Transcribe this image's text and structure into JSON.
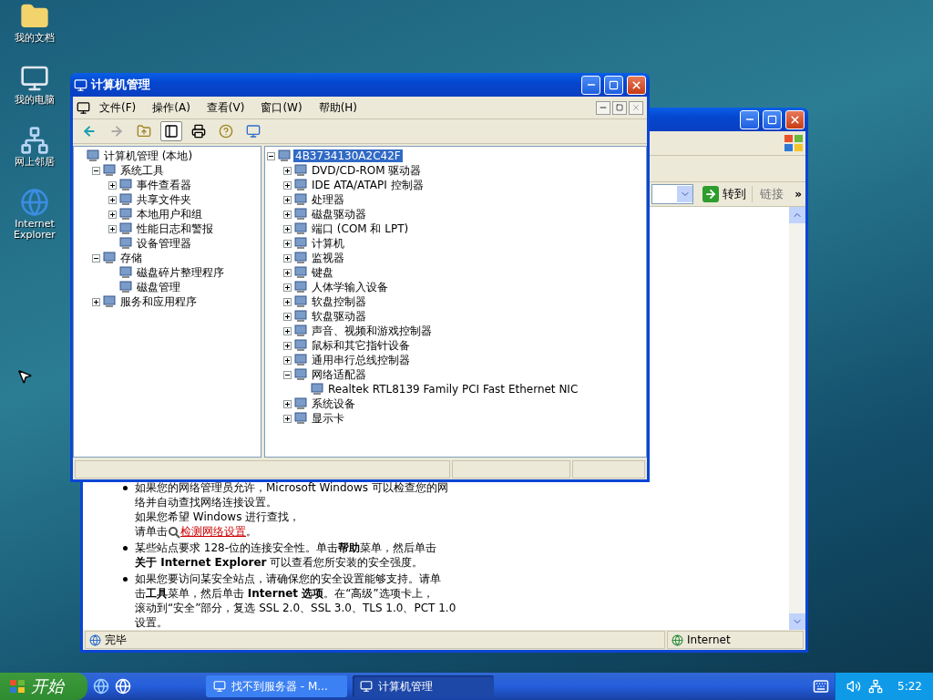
{
  "desktop_icons": [
    {
      "label": "我的文档"
    },
    {
      "label": "我的电脑"
    },
    {
      "label": "网上邻居"
    },
    {
      "label": "Internet Explorer"
    }
  ],
  "browser_window": {
    "go_button": "转到",
    "links": "链接",
    "chevron": "»",
    "bullets": [
      {
        "lines": [
          "如果您的网络管理员允许，Microsoft Windows 可以检查您的网",
          "络并自动查找网络连接设置。",
          "如果您希望 Windows 进行查找，"
        ],
        "link": {
          "prefix": "请单击",
          "text": "检测网络设置",
          "suffix": "。"
        }
      },
      {
        "lines": [
          "某些站点要求 128-位的连接安全性。单击**帮助**菜单，然后单击",
          "**关于 Internet Explorer** 可以查看您所安装的安全强度。"
        ]
      },
      {
        "lines": [
          "如果您要访问某安全站点，请确保您的安全设置能够支持。请单",
          "击**工具**菜单，然后单击 **Internet 选项**。在“高级”选项卡上，",
          "滚动到“安全”部分，复选 SSL 2.0、SSL 3.0、TLS 1.0、PCT 1.0",
          "设置。"
        ]
      }
    ],
    "status": "完毕",
    "zone": "Internet"
  },
  "main_window": {
    "title": "计算机管理",
    "menu": [
      "文件(F)",
      "操作(A)",
      "查看(V)",
      "窗口(W)",
      "帮助(H)"
    ],
    "left_tree": [
      {
        "label": "计算机管理 (本地)",
        "selected": false,
        "children": [
          {
            "label": "系统工具",
            "selected": false,
            "expanded": true,
            "children": [
              {
                "label": "事件查看器",
                "selected": false,
                "expanded": false
              },
              {
                "label": "共享文件夹",
                "selected": false,
                "expanded": false
              },
              {
                "label": "本地用户和组",
                "selected": false,
                "expanded": false
              },
              {
                "label": "性能日志和警报",
                "selected": false,
                "expanded": false
              },
              {
                "label": "设备管理器",
                "selected": false
              }
            ]
          },
          {
            "label": "存储",
            "selected": false,
            "expanded": true,
            "children": [
              {
                "label": "磁盘碎片整理程序",
                "selected": false
              },
              {
                "label": "磁盘管理",
                "selected": false
              }
            ]
          },
          {
            "label": "服务和应用程序",
            "selected": false,
            "expanded": false
          }
        ]
      }
    ],
    "device_tree": [
      {
        "label": "4B3734130A2C42F",
        "selected": true,
        "expanded": true,
        "children": [
          {
            "label": "DVD/CD-ROM 驱动器",
            "selected": false,
            "expanded": false
          },
          {
            "label": "IDE ATA/ATAPI 控制器",
            "selected": false,
            "expanded": false
          },
          {
            "label": "处理器",
            "selected": false,
            "expanded": false
          },
          {
            "label": "磁盘驱动器",
            "selected": false,
            "expanded": false
          },
          {
            "label": "端口 (COM 和 LPT)",
            "selected": false,
            "expanded": false
          },
          {
            "label": "计算机",
            "selected": false,
            "expanded": false
          },
          {
            "label": "监视器",
            "selected": false,
            "expanded": false
          },
          {
            "label": "键盘",
            "selected": false,
            "expanded": false
          },
          {
            "label": "人体学输入设备",
            "selected": false,
            "expanded": false
          },
          {
            "label": "软盘控制器",
            "selected": false,
            "expanded": false
          },
          {
            "label": "软盘驱动器",
            "selected": false,
            "expanded": false
          },
          {
            "label": "声音、视频和游戏控制器",
            "selected": false,
            "expanded": false
          },
          {
            "label": "鼠标和其它指针设备",
            "selected": false,
            "expanded": false
          },
          {
            "label": "通用串行总线控制器",
            "selected": false,
            "expanded": false
          },
          {
            "label": "网络适配器",
            "selected": false,
            "expanded": true,
            "children": [
              {
                "label": "Realtek RTL8139 Family PCI Fast Ethernet NIC",
                "selected": false
              }
            ]
          },
          {
            "label": "系统设备",
            "selected": false,
            "expanded": false
          },
          {
            "label": "显示卡",
            "selected": false,
            "expanded": false
          }
        ]
      }
    ]
  },
  "taskbar": {
    "start": "开始",
    "tasks": [
      {
        "label": "找不到服务器 - M...",
        "selected": false
      },
      {
        "label": "计算机管理",
        "selected": true
      }
    ],
    "clock": "5:22"
  }
}
